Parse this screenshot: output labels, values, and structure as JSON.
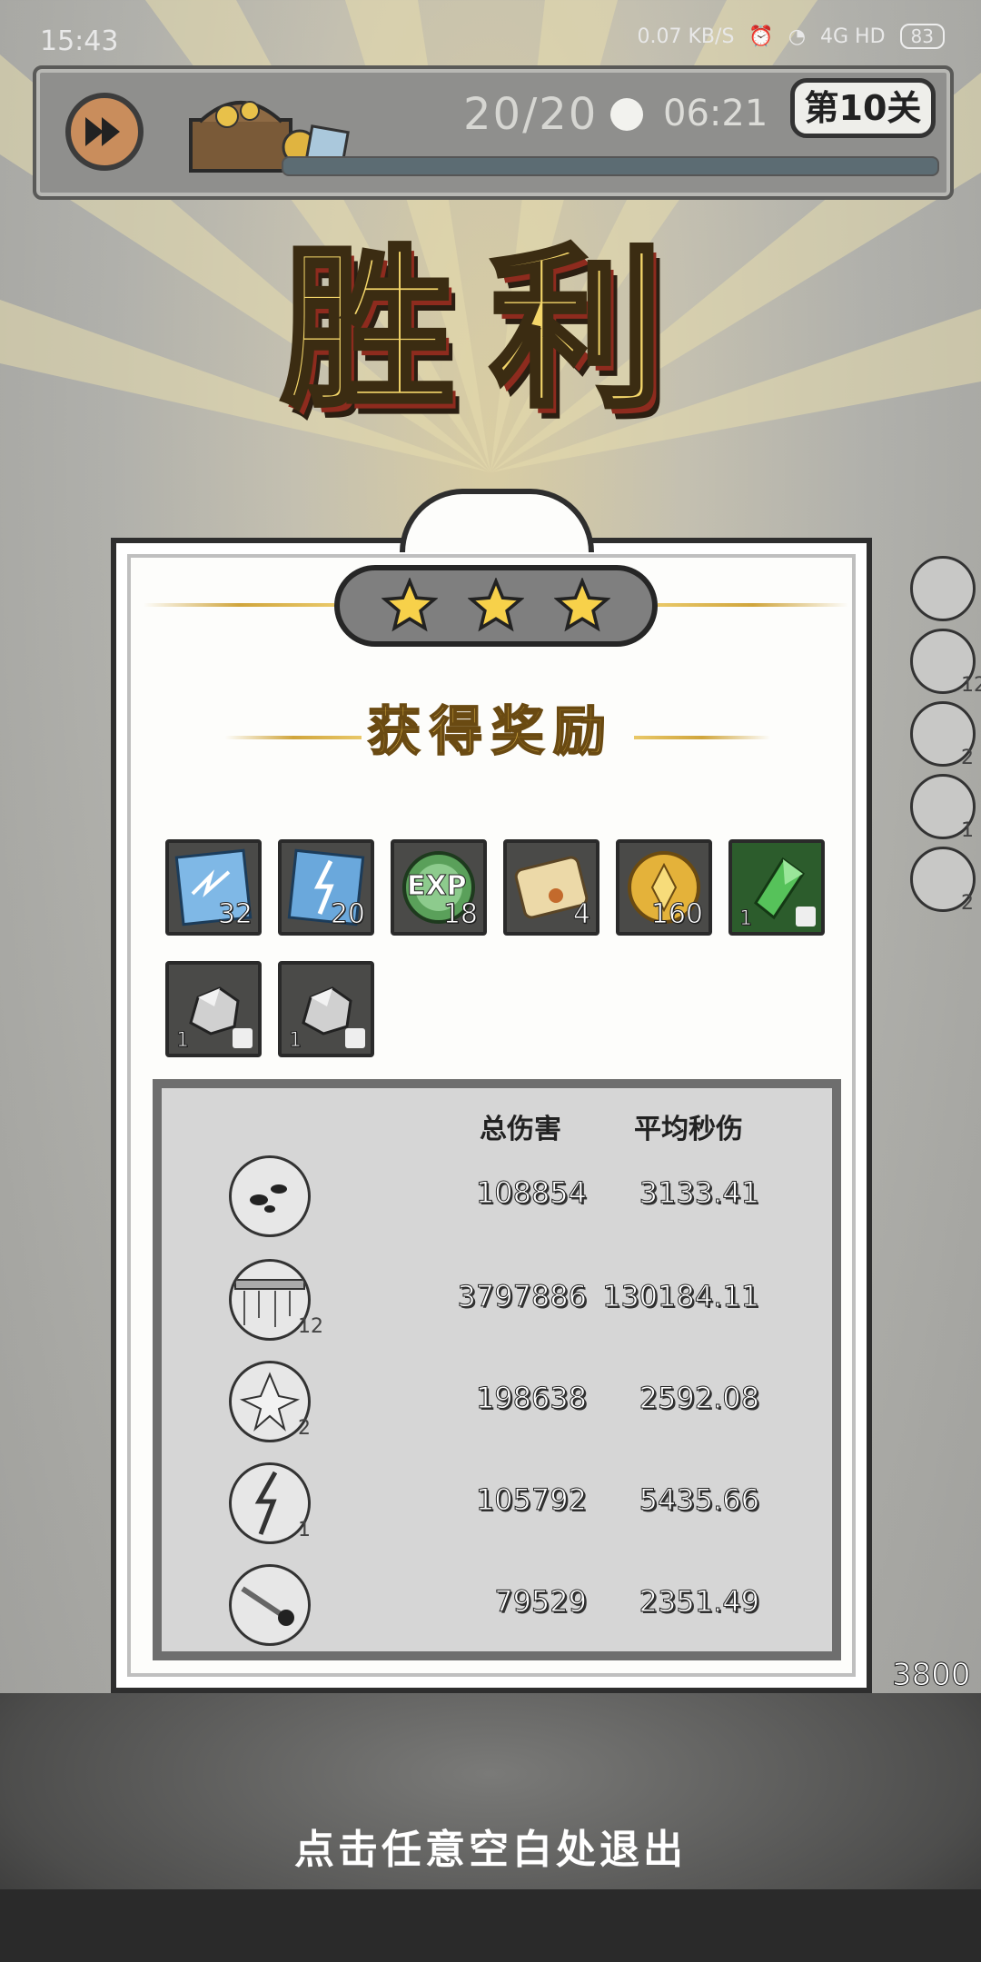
{
  "status_bar": {
    "time": "15:43",
    "net_speed": "0.07 KB/S",
    "network": "4G HD",
    "battery": "83"
  },
  "hud": {
    "wave": "20/20",
    "timer": "06:21",
    "level": "第10关"
  },
  "victory_title": "胜利",
  "stars": 3,
  "rewards_title": "获得奖励",
  "rewards": [
    {
      "icon": "ice-crystal-icon",
      "count": "32"
    },
    {
      "icon": "lightning-crystal-icon",
      "count": "20"
    },
    {
      "icon": "exp-icon",
      "label": "EXP",
      "count": "18"
    },
    {
      "icon": "scroll-icon",
      "count": "4"
    },
    {
      "icon": "gold-coin-icon",
      "count": "160"
    },
    {
      "icon": "green-gem-icon",
      "count": "1"
    },
    {
      "icon": "stone-icon",
      "count": "1"
    },
    {
      "icon": "stone-icon",
      "count": "1"
    }
  ],
  "stats": {
    "header_total": "总伤害",
    "header_dps": "平均秒伤",
    "rows": [
      {
        "skill": "ink-splash-skill-icon",
        "level": "",
        "total": "108854",
        "dps": "3133.41"
      },
      {
        "skill": "spike-trap-skill-icon",
        "level": "12",
        "total": "3797886",
        "dps": "130184.11"
      },
      {
        "skill": "crystal-burst-skill-icon",
        "level": "2",
        "total": "198638",
        "dps": "2592.08"
      },
      {
        "skill": "lightning-skill-icon",
        "level": "1",
        "total": "105792",
        "dps": "5435.66"
      },
      {
        "skill": "meteor-skill-icon",
        "level": "",
        "total": "79529",
        "dps": "2351.49"
      }
    ]
  },
  "side_skills": [
    {
      "icon": "ink-splash-skill-icon",
      "level": ""
    },
    {
      "icon": "spike-trap-skill-icon",
      "level": "12"
    },
    {
      "icon": "crystal-burst-skill-icon",
      "level": "2"
    },
    {
      "icon": "lightning-skill-icon",
      "level": "1"
    },
    {
      "icon": "meteor-skill-icon",
      "level": "2"
    }
  ],
  "gold_total": "3800",
  "exit_hint": "点击任意空白处退出",
  "colors": {
    "star": "#f7d14a",
    "title_gold": "#f4d66a",
    "panel_bg": "#fdfdfb",
    "stats_bg": "#d6d6d6"
  }
}
